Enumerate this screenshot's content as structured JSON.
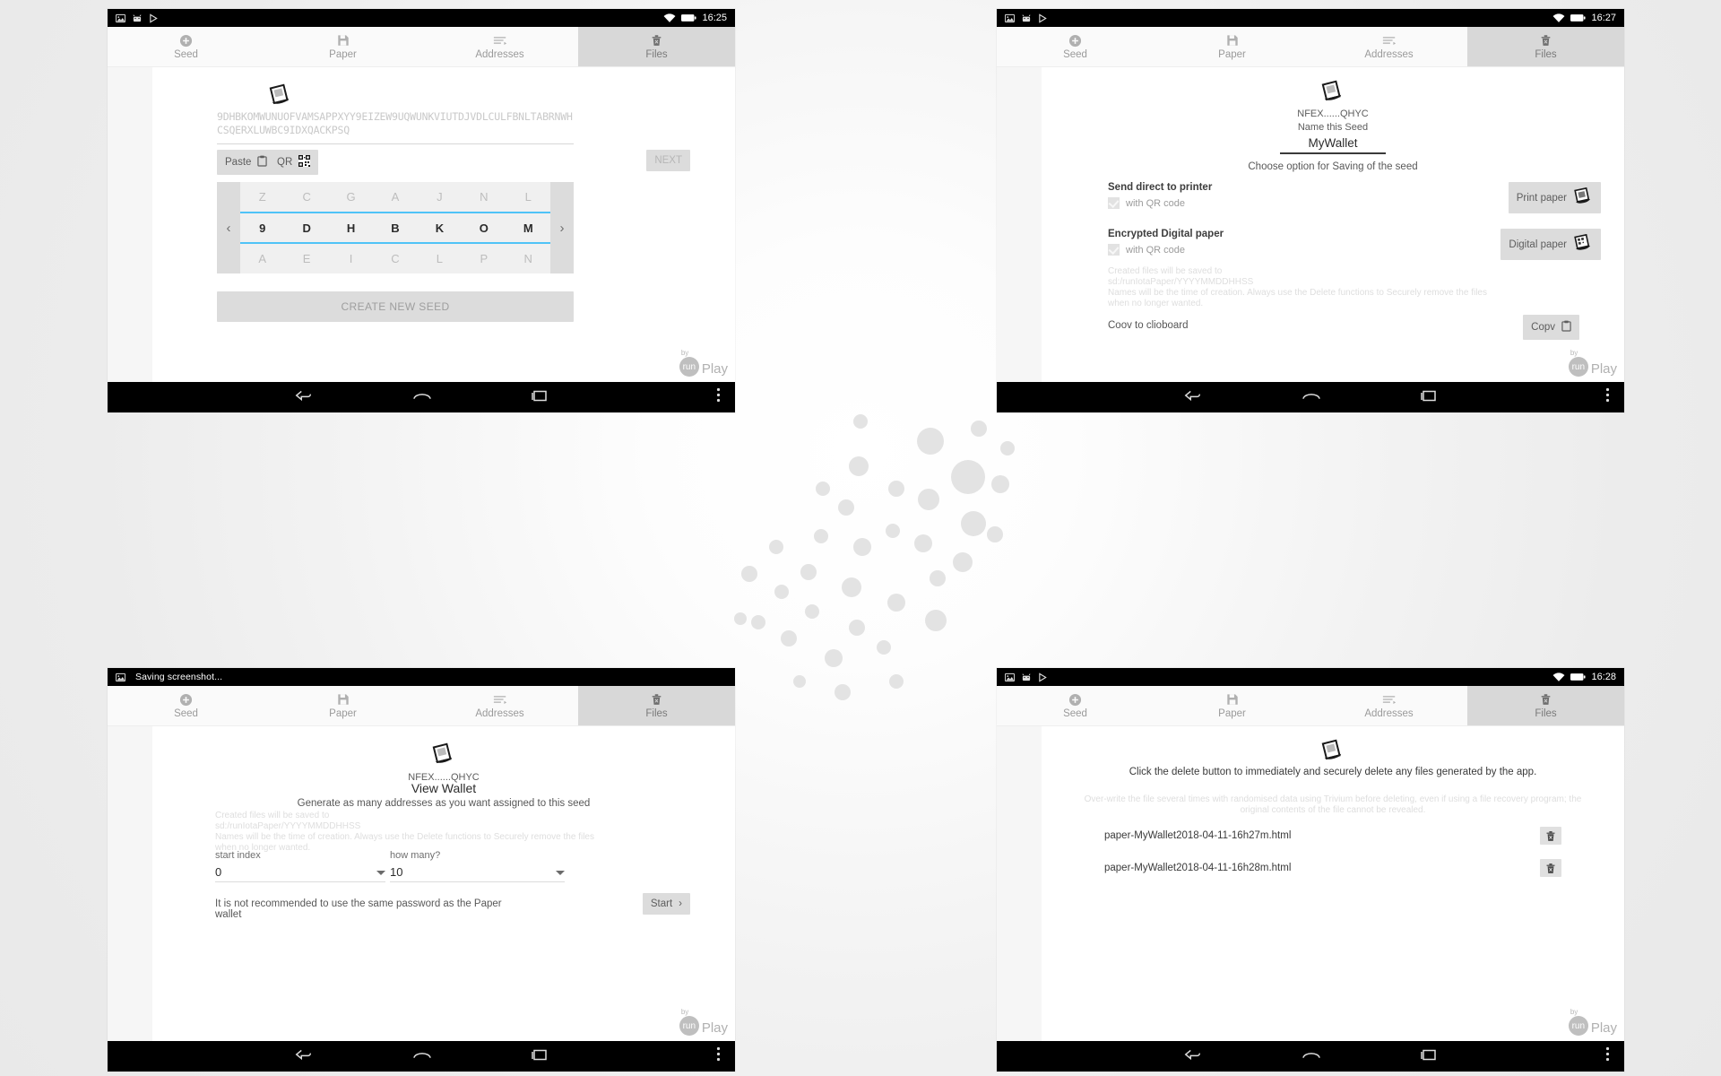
{
  "common": {
    "tabs": [
      {
        "label": "Seed",
        "icon": "plus-circle-icon"
      },
      {
        "label": "Paper",
        "icon": "save-disk-icon"
      },
      {
        "label": "Addresses",
        "icon": "list-lines-icon"
      },
      {
        "label": "Files",
        "icon": "trash-icon"
      }
    ],
    "brand": {
      "by": "by",
      "run": "run",
      "play": "Play"
    },
    "nav": {
      "back": "back-icon",
      "home": "home-icon",
      "recents": "recents-icon",
      "menu": "menu-dots-icon"
    },
    "storage_note_line1": "Created files will be saved to",
    "storage_note_line2": "sd:/runIotaPaper/YYYYMMDDHHSS",
    "storage_note_line3": "Names will be the time of creation. Always use the Delete functions to Securely remove the files when no longer wanted."
  },
  "panel1": {
    "statusbar": {
      "clock": "16:25",
      "icons": [
        "image-icon",
        "android-icon",
        "play-icon"
      ],
      "wifi": "wifi-icon",
      "battery": "battery-icon"
    },
    "active_tab": "Files",
    "seed_value": "9DHBKOMWUNUOFVAMSAPPXYY9EIZEW9UQWUNKVIUTDJVDLCULFBNLTABRNWHCSQERXLUWBC9IDXQACKPSQ",
    "paste_label": "Paste",
    "paste_icon": "clipboard-icon",
    "qr_label": "QR",
    "qr_icon": "qr-code-icon",
    "next_label": "NEXT",
    "create_label": "CREATE NEW SEED",
    "picker": {
      "left_arrow": "chevron-left-icon",
      "right_arrow": "chevron-right-icon",
      "row_top": [
        "Z",
        "C",
        "G",
        "A",
        "J",
        "N",
        "L"
      ],
      "row_middle": [
        "9",
        "D",
        "H",
        "B",
        "K",
        "O",
        "M"
      ],
      "row_bottom": [
        "A",
        "E",
        "I",
        "C",
        "L",
        "P",
        "N"
      ]
    }
  },
  "panel2": {
    "statusbar": {
      "clock": "16:27"
    },
    "active_tab": "Files",
    "seed_id": "NFEX......QHYC",
    "name_label": "Name this Seed",
    "wallet_name": "MyWallet",
    "choose_option": "Choose option for Saving of the seed",
    "print_section_title": "Send direct to printer",
    "print_qr_label": "with QR code",
    "print_button": "Print paper",
    "digital_section_title": "Encrypted Digital paper",
    "digital_qr_label": "with QR code",
    "digital_button": "Digital paper",
    "clipboard_label": "Coov to clioboard",
    "copy_button": "Copv",
    "copy_icon": "clipboard-icon"
  },
  "panel3": {
    "statusbar": {
      "text": "Saving screenshot...",
      "icon": "image-icon"
    },
    "active_tab": "Files",
    "seed_id": "NFEX......QHYC",
    "title": "View Wallet",
    "subtitle": "Generate as many addresses as you want assigned to this seed",
    "start_index_label": "start index",
    "start_index_value": "0",
    "how_many_label": "how many?",
    "how_many_value": "10",
    "password_note": "It is not recommended to use the same password as the Paper wallet",
    "start_button": "Start",
    "start_icon": "chevron-right-icon"
  },
  "panel4": {
    "statusbar": {
      "clock": "16:28"
    },
    "active_tab": "Files",
    "headline": "Click the delete button to immediately and securely delete any files generated by the app.",
    "subnote": "Over-write the file several times with randomised data using Trivium before deleting, even if using a file recovery program; the original contents of the file cannot be revealed.",
    "files": [
      {
        "name": "paper-MyWallet2018-04-11-16h27m.html",
        "delete_icon": "trash-icon"
      },
      {
        "name": "paper-MyWallet2018-04-11-16h28m.html",
        "delete_icon": "trash-icon"
      }
    ]
  },
  "colors": {
    "accent_blue": "#4fc3f7",
    "tab_active_bg": "#d8d8d8",
    "chip_bg": "#dcdcdc",
    "muted_text": "#c9c9c9"
  }
}
